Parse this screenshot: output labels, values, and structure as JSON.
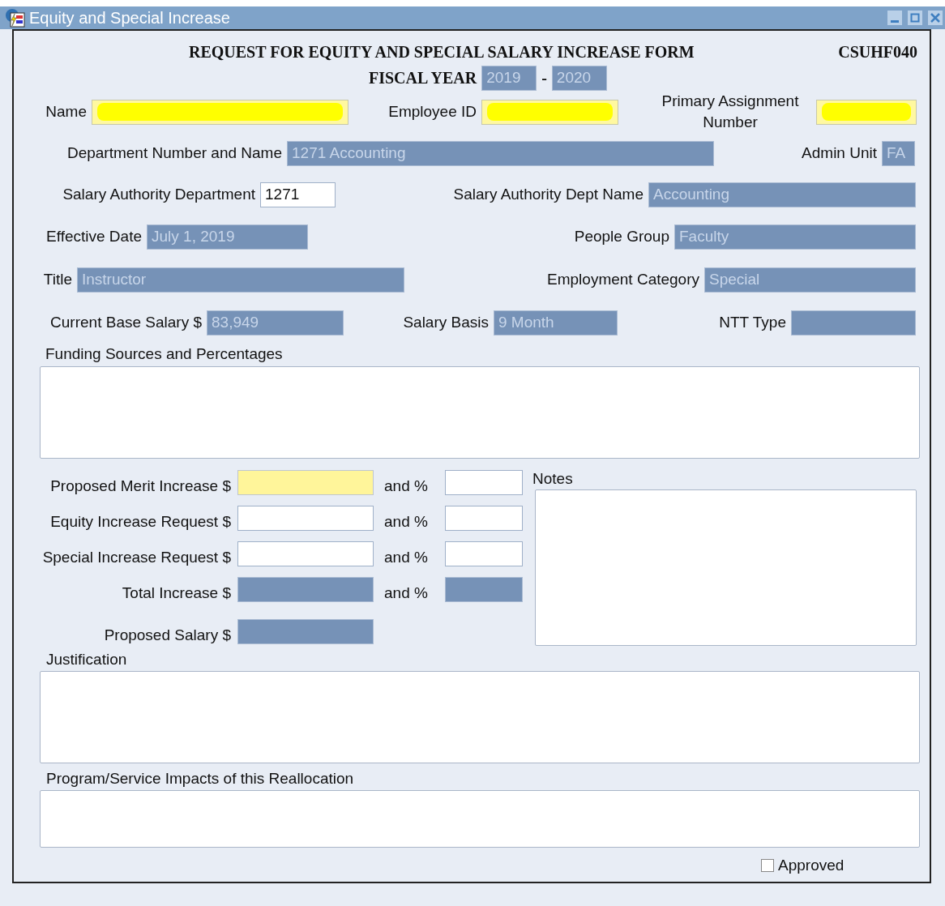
{
  "window": {
    "title": "Equity and Special Increase"
  },
  "header": {
    "title": "REQUEST FOR EQUITY AND SPECIAL SALARY INCREASE FORM",
    "form_code": "CSUHF040",
    "fiscal_label": "FISCAL YEAR",
    "year_start": "2019",
    "separator": "-",
    "year_end": "2020"
  },
  "rows": [
    [
      {
        "label": "Name",
        "kind": "redacted"
      },
      {
        "label": "Employee ID",
        "kind": "redacted"
      },
      {
        "label": "Primary Assignment Number",
        "kind": "redacted"
      }
    ],
    [
      {
        "label": "Department Number and Name",
        "kind": "readonly",
        "value": "1271 Accounting"
      },
      {
        "label": "Admin Unit",
        "kind": "readonly",
        "value": "FA"
      }
    ],
    [
      {
        "label": "Salary Authority Department",
        "kind": "input",
        "value": "1271"
      },
      {
        "label": "Salary Authority Dept Name",
        "kind": "readonly",
        "value": "Accounting"
      }
    ],
    [
      {
        "label": "Effective Date",
        "kind": "readonly",
        "value": "July 1, 2019"
      },
      {
        "label": "People Group",
        "kind": "readonly",
        "value": "Faculty"
      }
    ],
    [
      {
        "label": "Title",
        "kind": "readonly",
        "value": "Instructor"
      },
      {
        "label": "Employment Category",
        "kind": "readonly",
        "value": "Special"
      }
    ],
    [
      {
        "label": "Current Base Salary $",
        "kind": "readonly",
        "value": "83,949"
      },
      {
        "label": "Salary Basis",
        "kind": "readonly",
        "value": "9 Month"
      },
      {
        "label": "NTT Type",
        "kind": "readonly"
      }
    ]
  ],
  "funding": {
    "label": "Funding Sources and Percentages"
  },
  "increases": [
    {
      "label": "Proposed Merit Increase $",
      "kind": "highlight",
      "percent": {
        "label": "and %",
        "kind": "input"
      }
    },
    {
      "label": "Equity Increase Request $",
      "kind": "input",
      "percent": {
        "label": "and %",
        "kind": "input"
      }
    },
    {
      "label": "Special Increase Request $",
      "kind": "input",
      "percent": {
        "label": "and %",
        "kind": "input"
      }
    },
    {
      "label": "Total Increase $",
      "kind": "readonly",
      "percent": {
        "label": "and %",
        "kind": "readonly"
      }
    },
    {
      "label": "Proposed Salary $",
      "kind": "readonly"
    }
  ],
  "notes": {
    "label": "Notes"
  },
  "justification": {
    "label": "Justification"
  },
  "impacts": {
    "label": "Program/Service Impacts of this Reallocation"
  },
  "approved": {
    "label": "Approved",
    "checked": false
  }
}
